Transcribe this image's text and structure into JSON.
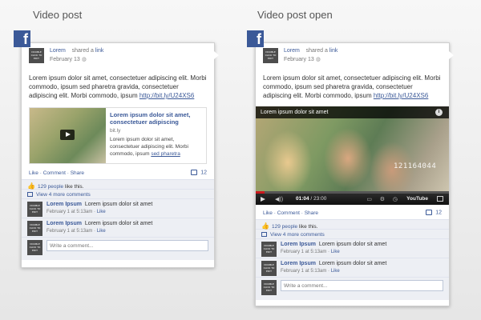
{
  "titles": {
    "left": "Video post",
    "right": "Video post open"
  },
  "fb_letter": "f",
  "avatar_text": "DOUBLE CLICK TO EDIT",
  "post": {
    "author": "Lorem",
    "shared_a": "shared a",
    "link_word": "link",
    "date": "February 13",
    "globe": "◍",
    "body": "Lorem ipsum dolor sit amet, consectetuer adipiscing elit. Morbi commodo, ipsum sed pharetra gravida, consectetuer adipiscing elit. Morbi commodo, ipsum",
    "url": "http://bit.ly/U24XS6"
  },
  "attachment": {
    "title": "Lorem ipsum dolor sit amet, consectetuer adipiscing",
    "domain": "bit.ly",
    "desc": "Lorem ipsum dolor sit amet, consectetuer adipiscing elit. Morbi commodo, ipsum",
    "desc_link": "sed pharetra"
  },
  "video": {
    "title": "Lorem ipsum dolor sit amet",
    "info": "i",
    "shirt_text": "121164044",
    "time_current": "01:04",
    "time_total": "23:00",
    "progress": 0.047,
    "youtube": "YouTube"
  },
  "actions": {
    "like": "Like",
    "comment": "Comment",
    "share": "Share",
    "sep": " · ",
    "count": "12"
  },
  "likes": {
    "count_text": "129 people",
    "suffix": "like this."
  },
  "more_comments": "View 4 more comments",
  "comments": [
    {
      "name": "Lorem Ipsum",
      "text": "Lorem ipsum dolor sit amet",
      "meta": "February 1 at 5:13am · ",
      "like": "Like"
    },
    {
      "name": "Lorem Ipsum",
      "text": "Lorem ipsum dolor sit amet",
      "meta": "February 1 at 5:13am · ",
      "like": "Like"
    }
  ],
  "write_placeholder": "Write a comment...",
  "icons": {
    "thumb": "thumbs-up-icon",
    "comment": "comment-icon",
    "play": "play-icon",
    "volume": "volume-icon",
    "fullscreen": "fullscreen-icon"
  },
  "colors": {
    "facebook_blue": "#3b5998",
    "ufi_bg": "#edeff4",
    "video_progress": "#cc181e"
  }
}
